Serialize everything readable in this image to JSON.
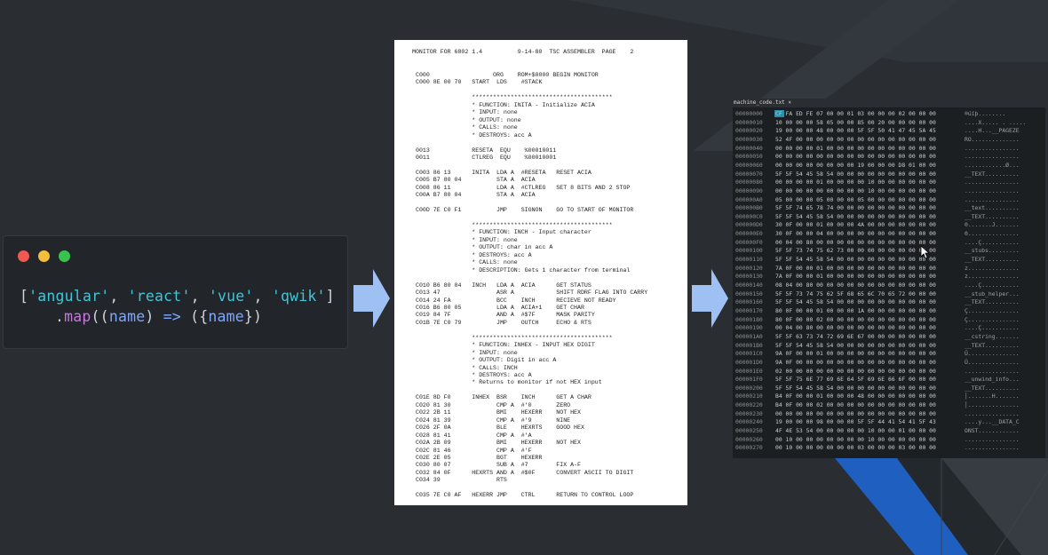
{
  "colors": {
    "background": "#2a2e33",
    "arrow": "#9fc0f2",
    "blue_stripe": "#1f5fc0",
    "dot_red": "#ee5a52",
    "dot_yellow": "#f4bd3b",
    "dot_green": "#39c24d"
  },
  "code_window": {
    "dots": [
      "close-dot",
      "minimize-dot",
      "maximize-dot"
    ],
    "line1": {
      "open": "[",
      "s1": "'angular'",
      "c1": ", ",
      "s2": "'react'",
      "c2": ", ",
      "s3": "'vue'",
      "c3": ", ",
      "s4": "'qwik'",
      "close": "]"
    },
    "line2": {
      "dot": ".",
      "fn": "map",
      "open": "((",
      "arg": "name",
      "mid": ") ",
      "arrow": "=>",
      "open2": " ({",
      "field": "name",
      "close": "})"
    }
  },
  "listing": {
    "header": "MONITOR FOR 6802 1.4          9-14-80  TSC ASSEMBLER  PAGE    2",
    "lines": [
      "C000                  ORG    ROM+$0000 BEGIN MONITOR",
      "C000 8E 00 70   START  LDS    #STACK",
      "",
      "                ****************************************",
      "                * FUNCTION: INITA - Initialize ACIA",
      "                * INPUT: none",
      "                * OUTPUT: none",
      "                * CALLS: none",
      "                * DESTROYS: acc A",
      "",
      "0013            RESETA  EQU    %00010011",
      "0011            CTLREG  EQU    %00010001",
      "",
      "C003 86 13      INITA  LDA A  #RESETA   RESET ACIA",
      "C005 B7 80 04          STA A  ACIA",
      "C008 86 11             LDA A  #CTLREG   SET 8 BITS AND 2 STOP",
      "C00A B7 80 04          STA A  ACIA",
      "",
      "C00D 7E C0 F1          JMP    SIGNON    GO TO START OF MONITOR",
      "",
      "                ****************************************",
      "                * FUNCTION: INCH - Input character",
      "                * INPUT: none",
      "                * OUTPUT: char in acc A",
      "                * DESTROYS: acc A",
      "                * CALLS: none",
      "                * DESCRIPTION: Gets 1 character from terminal",
      "",
      "C010 B6 80 04   INCH   LDA A  ACIA      GET STATUS",
      "C013 47                ASR A            SHIFT RDRF FLAG INTO CARRY",
      "C014 24 FA             BCC    INCH      RECIEVE NOT READY",
      "C016 B6 80 05          LDA A  ACIA+1    GET CHAR",
      "C019 84 7F             AND A  #$7F      MASK PARITY",
      "C01B 7E C0 79          JMP    OUTCH     ECHO & RTS",
      "",
      "                ****************************************",
      "                * FUNCTION: INHEX - INPUT HEX DIGIT",
      "                * INPUT: none",
      "                * OUTPUT: Digit in acc A",
      "                * CALLS: INCH",
      "                * DESTROYS: acc A",
      "                * Returns to monitor if not HEX input",
      "",
      "C01E 8D F0      INHEX  BSR    INCH      GET A CHAR",
      "C020 81 30             CMP A  #'0       ZERO",
      "C022 2B 11             BMI    HEXERR    NOT HEX",
      "C024 81 39             CMP A  #'9       NINE",
      "C026 2F 0A             BLE    HEXRTS    GOOD HEX",
      "C028 81 41             CMP A  #'A",
      "C02A 2B 09             BMI    HEXERR    NOT HEX",
      "C02C 81 46             CMP A  #'F",
      "C02E 2E 05             BGT    HEXERR",
      "C030 80 07             SUB A  #7        FIX A-F",
      "C032 84 0F      HEXRTS AND A  #$0F      CONVERT ASCII TO DIGIT",
      "C034 39                RTS",
      "",
      "C035 7E C0 AF   HEXERR JMP    CTRL      RETURN TO CONTROL LOOP"
    ]
  },
  "hex_editor": {
    "tab_label": "machine_code.txt ×",
    "rows": [
      {
        "off": "00000000",
        "bytes": "CF FA ED FE 07 00 00 01 03 00 00 00 02 00 00 00",
        "ascii": "®úíþ........"
      },
      {
        "off": "00000010",
        "bytes": "10 00 00 00 58 05 00 00 85 00 20 00 00 00 00 00",
        "ascii": "....X..... . ....."
      },
      {
        "off": "00000020",
        "bytes": "19 00 00 00 48 00 00 00 5F 5F 50 41 47 45 5A 45",
        "ascii": "....H...__PAGEZE"
      },
      {
        "off": "00000030",
        "bytes": "52 4F 00 00 00 00 00 00 00 00 00 00 00 00 00 00",
        "ascii": "RO.............."
      },
      {
        "off": "00000040",
        "bytes": "00 00 00 00 01 00 00 00 00 00 00 00 00 00 00 00",
        "ascii": "................"
      },
      {
        "off": "00000050",
        "bytes": "00 00 00 00 00 00 00 00 00 00 00 00 00 00 00 00",
        "ascii": "................"
      },
      {
        "off": "00000060",
        "bytes": "00 00 00 00 00 00 00 00 19 00 00 00 D8 01 00 00",
        "ascii": "............Ø..."
      },
      {
        "off": "00000070",
        "bytes": "5F 5F 54 45 58 54 00 00 00 00 00 00 00 00 00 00",
        "ascii": "__TEXT.........."
      },
      {
        "off": "00000080",
        "bytes": "00 00 00 00 01 00 00 00 00 10 00 00 00 00 00 00",
        "ascii": "................"
      },
      {
        "off": "00000090",
        "bytes": "00 00 00 00 00 00 00 00 00 10 00 00 00 00 00 00",
        "ascii": "................"
      },
      {
        "off": "000000A0",
        "bytes": "05 00 00 00 05 00 00 00 05 00 00 00 00 00 00 00",
        "ascii": "................"
      },
      {
        "off": "000000B0",
        "bytes": "5F 5F 74 65 78 74 00 00 00 00 00 00 00 00 00 00",
        "ascii": "__text.........."
      },
      {
        "off": "000000C0",
        "bytes": "5F 5F 54 45 58 54 00 00 00 00 00 00 00 00 00 00",
        "ascii": "__TEXT.........."
      },
      {
        "off": "000000D0",
        "bytes": "30 0F 00 00 01 00 00 00 4A 00 00 00 00 00 00 00",
        "ascii": "0.......J......."
      },
      {
        "off": "000000E0",
        "bytes": "30 0F 00 00 04 00 00 00 00 00 00 00 00 00 00 00",
        "ascii": "0..............."
      },
      {
        "off": "000000F0",
        "bytes": "00 04 00 80 00 00 00 00 00 00 00 00 00 00 00 00",
        "ascii": "....Ç..........."
      },
      {
        "off": "00000100",
        "bytes": "5F 5F 73 74 75 62 73 00 00 00 00 00 00 00 00 00",
        "ascii": "__stubs........."
      },
      {
        "off": "00000110",
        "bytes": "5F 5F 54 45 58 54 00 00 00 00 00 00 00 00 00 00",
        "ascii": "__TEXT.........."
      },
      {
        "off": "00000120",
        "bytes": "7A 0F 00 00 01 00 00 00 00 00 00 00 00 00 00 00",
        "ascii": "z..............."
      },
      {
        "off": "00000130",
        "bytes": "7A 0F 00 00 01 00 00 00 00 00 00 00 00 00 00 00",
        "ascii": "z..............."
      },
      {
        "off": "00000140",
        "bytes": "08 04 00 80 00 00 00 00 00 00 00 00 00 00 00 00",
        "ascii": "....Ç..........."
      },
      {
        "off": "00000150",
        "bytes": "5F 5F 73 74 75 62 5F 68 65 6C 70 65 72 00 00 00",
        "ascii": "__stub_helper..."
      },
      {
        "off": "00000160",
        "bytes": "5F 5F 54 45 58 54 00 00 00 00 00 00 00 00 00 00",
        "ascii": "__TEXT.........."
      },
      {
        "off": "00000170",
        "bytes": "80 0F 00 00 01 00 00 00 1A 00 00 00 00 00 00 00",
        "ascii": "Ç..............."
      },
      {
        "off": "00000180",
        "bytes": "80 0F 00 00 02 00 00 00 00 00 00 00 00 00 00 00",
        "ascii": "Ç..............."
      },
      {
        "off": "00000190",
        "bytes": "00 04 00 80 00 00 00 00 00 00 00 00 00 00 00 00",
        "ascii": "....Ç..........."
      },
      {
        "off": "000001A0",
        "bytes": "5F 5F 63 73 74 72 69 6E 67 00 00 00 00 00 00 00",
        "ascii": "__cstring......."
      },
      {
        "off": "000001B0",
        "bytes": "5F 5F 54 45 58 54 00 00 00 00 00 00 00 00 00 00",
        "ascii": "__TEXT.........."
      },
      {
        "off": "000001C0",
        "bytes": "9A 0F 00 00 01 00 00 00 00 00 00 00 00 00 00 00",
        "ascii": "Ü..............."
      },
      {
        "off": "000001D0",
        "bytes": "9A 0F 00 00 00 00 00 00 00 00 00 00 00 00 00 00",
        "ascii": "Ü..............."
      },
      {
        "off": "000001E0",
        "bytes": "02 00 00 00 00 00 00 00 00 00 00 00 00 00 00 00",
        "ascii": "................"
      },
      {
        "off": "000001F0",
        "bytes": "5F 5F 75 6E 77 69 6E 64 5F 69 6E 66 6F 00 00 00",
        "ascii": "__unwind_info..."
      },
      {
        "off": "00000200",
        "bytes": "5F 5F 54 45 58 54 00 00 00 00 00 00 00 00 00 00",
        "ascii": "__TEXT.........."
      },
      {
        "off": "00000210",
        "bytes": "B4 0F 00 00 01 00 00 00 48 00 00 00 00 00 00 00",
        "ascii": "│.......H......."
      },
      {
        "off": "00000220",
        "bytes": "B4 0F 00 00 02 00 00 00 00 00 00 00 00 00 00 00",
        "ascii": "│..............."
      },
      {
        "off": "00000230",
        "bytes": "00 00 00 00 00 00 00 00 00 00 00 00 00 00 00 00",
        "ascii": "................"
      },
      {
        "off": "00000240",
        "bytes": "19 00 00 00 98 00 00 00 5F 5F 44 41 54 41 5F 43",
        "ascii": "....y...__DATA_C"
      },
      {
        "off": "00000250",
        "bytes": "4F 4E 53 54 00 00 00 00 00 10 00 00 01 00 00 00",
        "ascii": "ONST............"
      },
      {
        "off": "00000260",
        "bytes": "00 10 00 00 00 00 00 00 00 10 00 00 00 00 00 00",
        "ascii": "................"
      },
      {
        "off": "00000270",
        "bytes": "00 10 00 00 00 00 00 00 03 00 00 00 03 00 00 00",
        "ascii": "................"
      }
    ]
  }
}
